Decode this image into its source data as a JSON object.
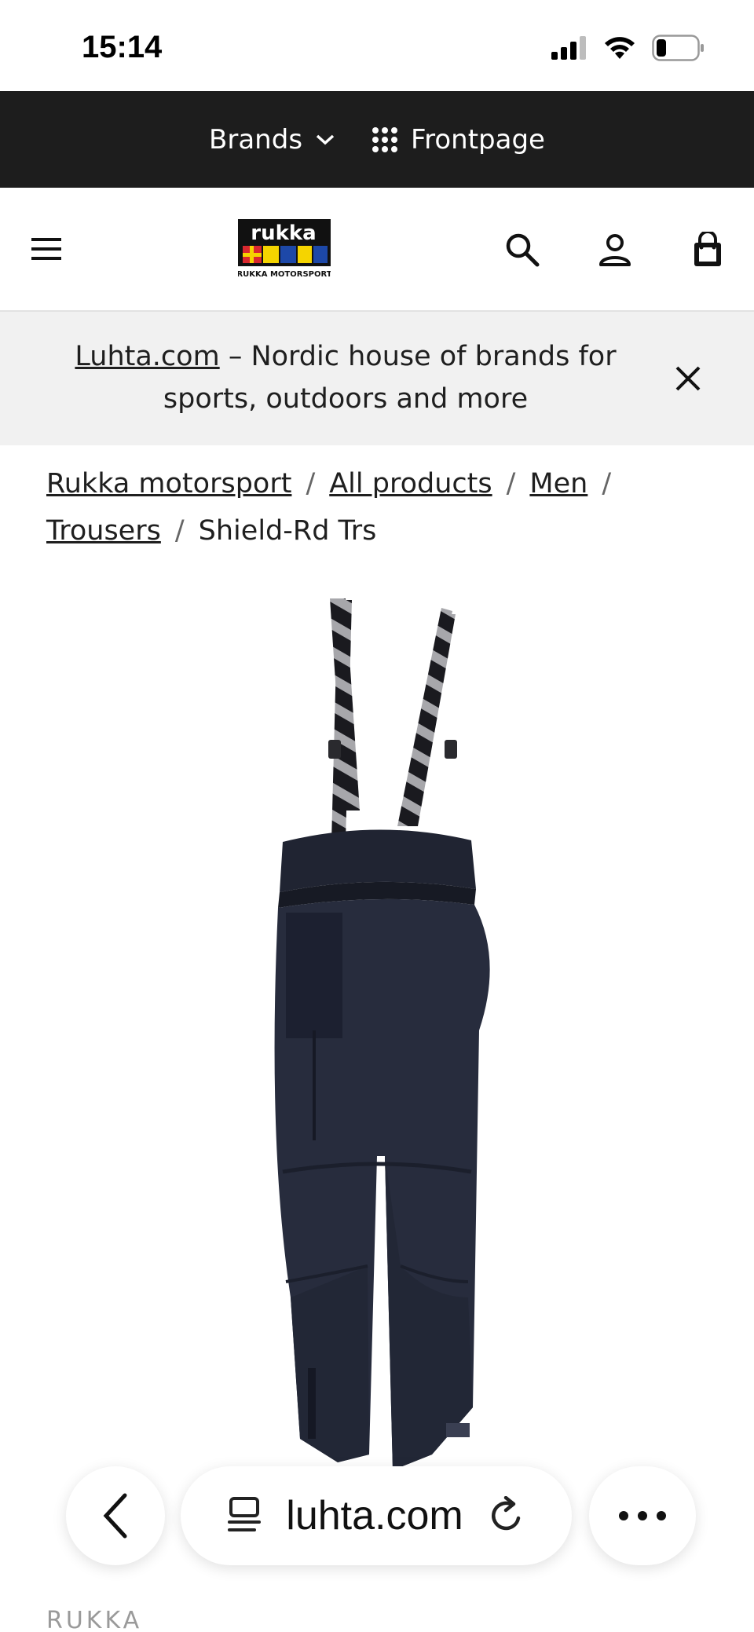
{
  "status_bar": {
    "time": "15:14"
  },
  "brand_bar": {
    "brands_label": "Brands",
    "frontpage_label": "Frontpage"
  },
  "header": {
    "logo_text": "rukka",
    "logo_subtext": "RUKKA MOTORSPORT"
  },
  "banner": {
    "link_text": "Luhta.com",
    "text": " – Nordic house of brands for sports, outdoors and more"
  },
  "breadcrumb": {
    "items": [
      "Rukka motorsport",
      "All products",
      "Men",
      "Trousers"
    ],
    "current": "Shield-Rd Trs",
    "separator": "/"
  },
  "product": {
    "brand": "RUKKA"
  },
  "browser": {
    "url": "luhta.com"
  },
  "colors": {
    "dark_bar": "#1d1d1d",
    "banner_bg": "#f1f1f1",
    "text": "#1f1f1f"
  }
}
